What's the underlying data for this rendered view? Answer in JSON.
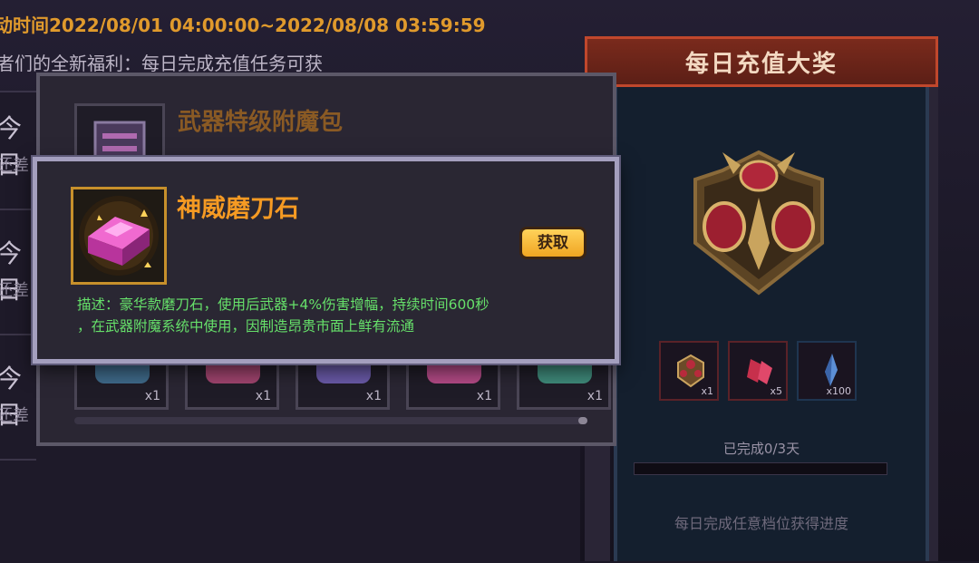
{
  "event": {
    "time_range": "动时间2022/08/01 04:00:00~2022/08/08 03:59:59",
    "sub_banner": "者们的全新福利：每日完成充值任务可获"
  },
  "left_list": {
    "rows": [
      {
        "day": "今日",
        "remaining": "还差"
      },
      {
        "day": "今日",
        "remaining": "还差"
      },
      {
        "day": "今日",
        "remaining": "还差"
      }
    ]
  },
  "daily_panel": {
    "title": "每日充值大奖",
    "rewards": [
      {
        "icon": "treasure-chest-icon",
        "quantity": "x1"
      },
      {
        "icon": "red-crystal-icon",
        "quantity": "x5"
      },
      {
        "icon": "blue-crystal-icon",
        "quantity": "x100"
      }
    ],
    "progress_label": "已完成0/3天",
    "progress_fraction": 0,
    "hint": "每日完成任意档位获得进度"
  },
  "back_popup": {
    "title": "武器特级附魔包",
    "items": [
      {
        "quantity": "x1",
        "color": "#3f6a8a"
      },
      {
        "quantity": "x1",
        "color": "#a0446e"
      },
      {
        "quantity": "x1",
        "color": "#6a5aa8"
      },
      {
        "quantity": "x1",
        "color": "#b34a86"
      },
      {
        "quantity": "x1",
        "color": "#3f8a7a"
      }
    ]
  },
  "item_popup": {
    "name": "神威磨刀石",
    "get_button": "获取",
    "description_line1": "描述：豪华款磨刀石，使用后武器+4%伤害增幅，持续时间600秒",
    "description_line2": "，在武器附魔系统中使用，因制造昂贵市面上鲜有流通"
  },
  "colors": {
    "title_orange": "#f59a23",
    "description_green": "#66e06a",
    "button_gold": "#f0a522",
    "header_red": "#7a2a1c"
  }
}
